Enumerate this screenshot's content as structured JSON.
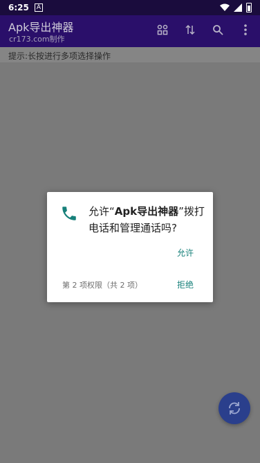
{
  "status_bar": {
    "time": "6:25",
    "notif_icon": "A"
  },
  "app_bar": {
    "title": "Apk导出神器",
    "subtitle": "cr173.com制作",
    "actions": [
      "grid-icon",
      "sort-icon",
      "search-icon",
      "more-icon"
    ]
  },
  "hint": "提示:长按进行多项选择操作",
  "dialog": {
    "message_prefix": "允许“",
    "app_name": "Apk导出神器",
    "message_suffix": "”拨打电话和管理通话吗?",
    "allow_label": "允许",
    "permission_count": "第 2 项权限（共 2 项）",
    "deny_label": "拒绝",
    "icon_color": "#17807a"
  },
  "fab": {
    "icon": "refresh-icon",
    "color": "#2a3f8c"
  }
}
